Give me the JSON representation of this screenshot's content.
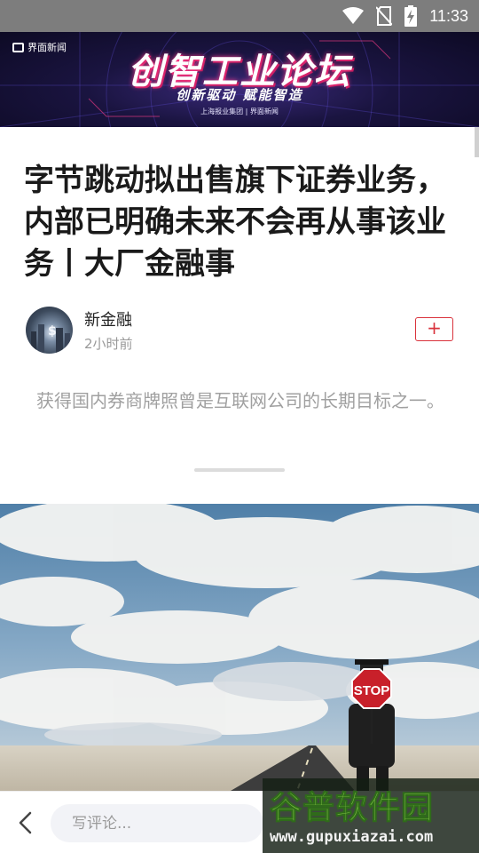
{
  "status_bar": {
    "time": "11:33",
    "icons": [
      "wifi-icon",
      "no-sim-icon",
      "battery-charging-icon"
    ]
  },
  "banner": {
    "logo_text": "界面新闻",
    "title": "创智工业论坛",
    "slogan": "创新驱动 赋能智造",
    "subtitle": "上海报业集团 | 界面新闻"
  },
  "article": {
    "headline": "字节跳动拟出售旗下证券业务，内部已明确未来不会再从事该业务丨大厂金融事",
    "author_name": "新金融",
    "post_time": "2小时前",
    "follow_label": "+",
    "summary": "获得国内券商牌照曾是互联网公司的长期目标之一。"
  },
  "image": {
    "sign_text": "STOP"
  },
  "bottom_bar": {
    "comment_placeholder": "写评论..."
  },
  "watermark": {
    "logo": "谷普软件园",
    "url": "www.gupuxiazai.com"
  },
  "colors": {
    "status_bar": "#7d7d7d",
    "accent_red": "#d9323c",
    "headline": "#1a1a1a",
    "summary": "#a0a0a0"
  }
}
